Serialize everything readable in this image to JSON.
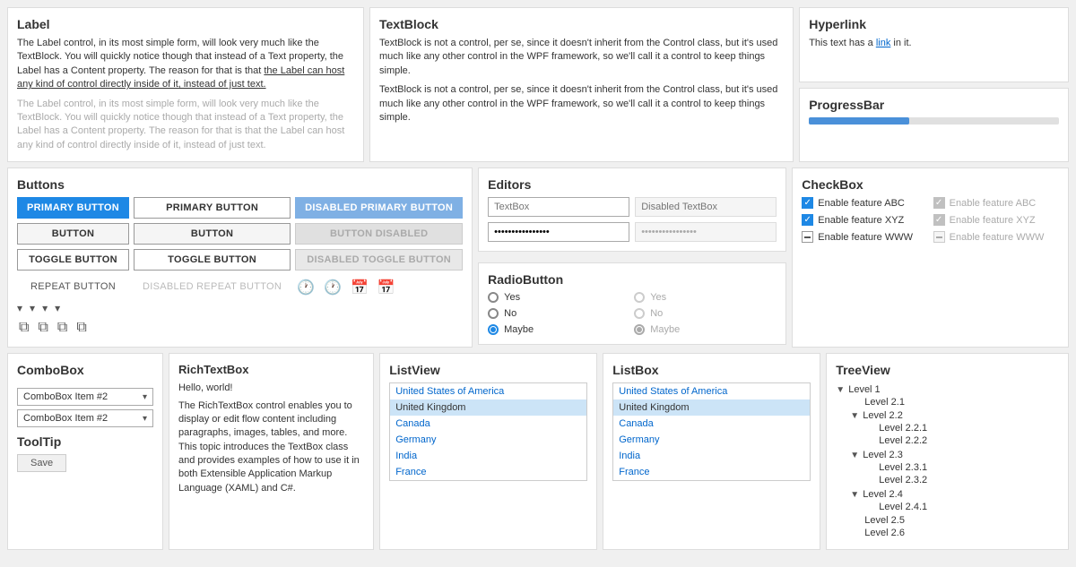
{
  "label": {
    "title": "Label",
    "text1": "The Label control, in its most simple form, will look very much like the TextBlock. You will quickly notice though that instead of a Text property, the Label has a Content property. The reason for that is that the Label can host any kind of control directly inside of it, instead of just text.",
    "text2": "The Label control, in its most simple form, will look very much like the TextBlock. You will quickly notice though that instead of a Text property, the Label has a Content property. The reason for that is that the Label can host any kind of control directly inside of it, instead of just text."
  },
  "textblock": {
    "title": "TextBlock",
    "text1": "TextBlock is not a control, per se, since it doesn't inherit from the Control class, but it's used much like any other control in the WPF framework, so we'll call it a control to keep things simple.",
    "text2": "TextBlock is not a control, per se, since it doesn't inherit from the Control class, but it's used much like any other control in the WPF framework, so we'll call it a control to keep things simple."
  },
  "hyperlink": {
    "title": "Hyperlink",
    "text_before": "This text has a",
    "link_text": "link",
    "text_after": "in it."
  },
  "progressbar": {
    "title": "ProgressBar",
    "value": 40
  },
  "buttons": {
    "title": "Buttons",
    "primary_label": "PRIMARY BUTTON",
    "primary_outline_label": "PRIMARY BUTTON",
    "primary_disabled_label": "DISABLED PRIMARY BUTTON",
    "button_label": "BUTTON",
    "button2_label": "BUTTON",
    "button_disabled_label": "BUTTON DISABLED",
    "toggle_label": "TOGGLE BUTTON",
    "toggle2_label": "TOGGLE BUTTON",
    "toggle_disabled_label": "DISABLED TOGGLE BUTTON",
    "repeat_label": "REPEAT BUTTON",
    "repeat_disabled_label": "DISABLED REPEAT BUTTON"
  },
  "editors": {
    "title": "Editors",
    "textbox_placeholder": "TextBox",
    "disabled_textbox_placeholder": "Disabled TextBox",
    "password_value": "••••••••••••••••",
    "password_disabled_value": "••••••••••••••••"
  },
  "radiobutton": {
    "title": "RadioButton",
    "options": [
      "Yes",
      "No",
      "Maybe"
    ],
    "selected": "Maybe",
    "disabled_options": [
      "Yes",
      "No",
      "Maybe"
    ],
    "disabled_selected": "Maybe"
  },
  "checkbox": {
    "title": "CheckBox",
    "items": [
      {
        "label": "Enable feature ABC",
        "state": "checked"
      },
      {
        "label": "Enable feature XYZ",
        "state": "checked"
      },
      {
        "label": "Enable feature WWW",
        "state": "indeterminate"
      }
    ],
    "disabled_items": [
      {
        "label": "Enable feature ABC",
        "state": "checked"
      },
      {
        "label": "Enable feature XYZ",
        "state": "checked"
      },
      {
        "label": "Enable feature WWW",
        "state": "indeterminate"
      }
    ]
  },
  "combobox": {
    "title": "ComboBox",
    "item1": "ComboBox Item #2",
    "item2": "ComboBox Item #2"
  },
  "tooltip": {
    "title": "ToolTip",
    "button_label": "Save"
  },
  "richtextbox": {
    "title": "RichTextBox",
    "greeting": "Hello, world!",
    "text": "The RichTextBox control enables you to display or edit flow content including paragraphs, images, tables, and more. This topic introduces the TextBox class and provides examples of how to use it in both Extensible Application Markup Language (XAML) and C#."
  },
  "listview": {
    "title": "ListView",
    "items": [
      {
        "label": "United States of America",
        "selected": false
      },
      {
        "label": "United Kingdom",
        "selected": true
      },
      {
        "label": "Canada",
        "selected": false
      },
      {
        "label": "Germany",
        "selected": false
      },
      {
        "label": "India",
        "selected": false
      },
      {
        "label": "France",
        "selected": false
      }
    ]
  },
  "listbox": {
    "title": "ListBox",
    "items": [
      {
        "label": "United States of America",
        "selected": false
      },
      {
        "label": "United Kingdom",
        "selected": true
      },
      {
        "label": "Canada",
        "selected": false
      },
      {
        "label": "Germany",
        "selected": false
      },
      {
        "label": "India",
        "selected": false
      },
      {
        "label": "France",
        "selected": false
      }
    ]
  },
  "treeview": {
    "title": "TreeView",
    "nodes": [
      {
        "label": "Level 1",
        "expanded": true,
        "children": [
          {
            "label": "Level 2.1",
            "expanded": false,
            "children": []
          },
          {
            "label": "Level 2.2",
            "expanded": true,
            "children": [
              {
                "label": "Level 2.2.1",
                "expanded": false,
                "children": []
              },
              {
                "label": "Level 2.2.2",
                "expanded": false,
                "children": []
              }
            ]
          },
          {
            "label": "Level 2.3",
            "expanded": true,
            "children": [
              {
                "label": "Level 2.3.1",
                "expanded": false,
                "children": []
              },
              {
                "label": "Level 2.3.2",
                "expanded": false,
                "children": []
              }
            ]
          },
          {
            "label": "Level 2.4",
            "expanded": true,
            "children": [
              {
                "label": "Level 2.4.1",
                "expanded": false,
                "children": []
              }
            ]
          },
          {
            "label": "Level 2.5",
            "expanded": false,
            "children": []
          },
          {
            "label": "Level 2.6",
            "expanded": false,
            "children": []
          }
        ]
      }
    ]
  }
}
